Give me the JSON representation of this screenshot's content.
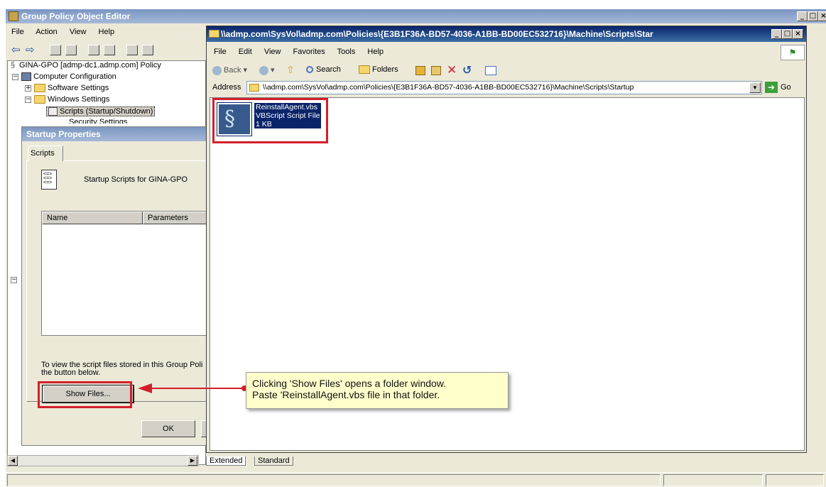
{
  "gpo": {
    "title": "Group Policy Object Editor",
    "menu": [
      "File",
      "Action",
      "View",
      "Help"
    ],
    "tree": {
      "root": "GINA-GPO [admp-dc1.admp.com] Policy",
      "computer": "Computer Configuration",
      "software": "Software Settings",
      "windows": "Windows Settings",
      "scripts": "Scripts (Startup/Shutdown)",
      "security": "Security Settings"
    },
    "tabs": [
      "Extended",
      "Standard"
    ]
  },
  "startup": {
    "title": "Startup Properties",
    "tab": "Scripts",
    "heading": "Startup Scripts for GINA-GPO",
    "columns": [
      "Name",
      "Parameters"
    ],
    "info": "To view the script files stored in this Group Poli",
    "info2": "the button below.",
    "show_files": "Show Files...",
    "ok": "OK"
  },
  "explorer": {
    "title": "\\\\admp.com\\SysVol\\admp.com\\Policies\\{E3B1F36A-BD57-4036-A1BB-BD00EC532716}\\Machine\\Scripts\\Star",
    "menu": [
      "File",
      "Edit",
      "View",
      "Favorites",
      "Tools",
      "Help"
    ],
    "toolbar": {
      "back": "Back",
      "search": "Search",
      "folders": "Folders"
    },
    "address_label": "Address",
    "address": "\\\\admp.com\\SysVol\\admp.com\\Policies\\{E3B1F36A-BD57-4036-A1BB-BD00EC532716}\\Machine\\Scripts\\Startup",
    "go": "Go",
    "file": {
      "name": "ReinstallAgent.vbs",
      "type": "VBScript Script File",
      "size": "1 KB"
    }
  },
  "callout": {
    "line1": "Clicking 'Show Files' opens a folder window.",
    "line2": "Paste 'ReinstallAgent.vbs file in that folder."
  },
  "colors": {
    "highlight": "#d41f2b",
    "callout_bg": "#ffffcc",
    "selection": "#0a246a"
  }
}
